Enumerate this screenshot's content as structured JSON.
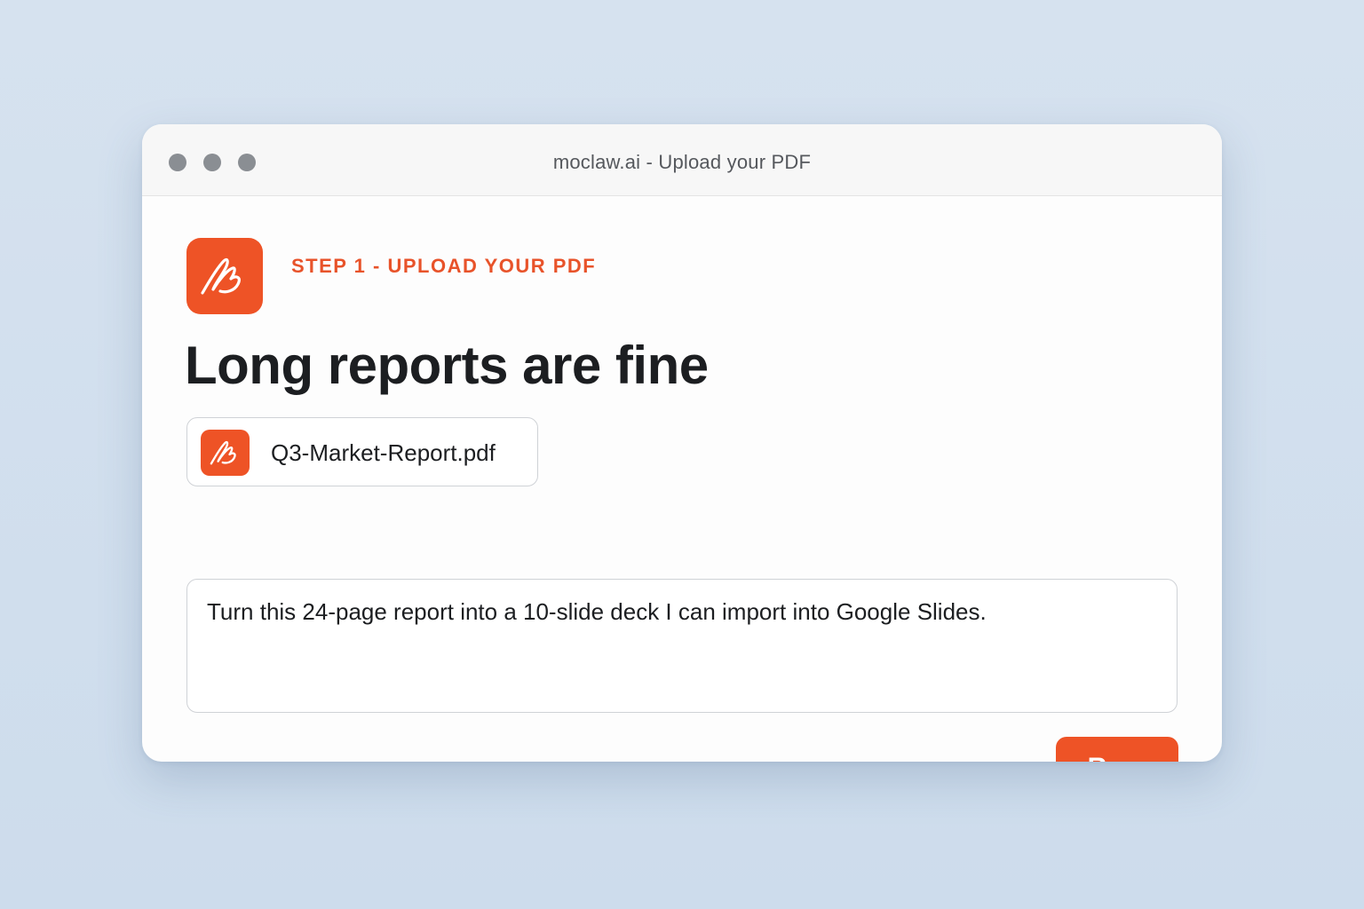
{
  "window": {
    "title": "moclaw.ai - Upload your PDF"
  },
  "app": {
    "logo_icon": "signature-scribble-icon",
    "brand_color": "#ee5326"
  },
  "step": {
    "label": "STEP 1 - UPLOAD YOUR PDF"
  },
  "main": {
    "headline": "Long reports are fine",
    "attachment": {
      "file_name": "Q3-Market-Report.pdf",
      "icon": "signature-scribble-icon"
    },
    "prompt": {
      "value": "Turn this 24-page report into a 10-slide deck I can import into Google Slides."
    },
    "run_label": "Run."
  }
}
